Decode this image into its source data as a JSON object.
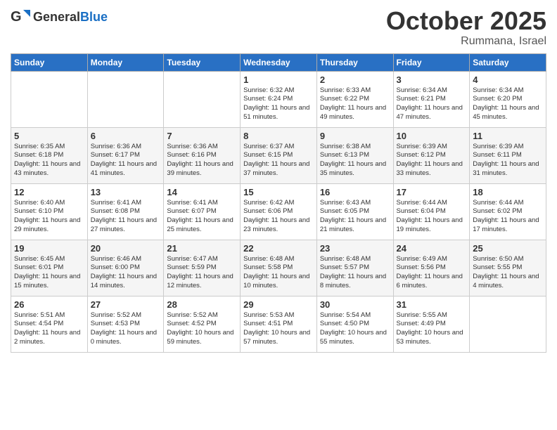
{
  "header": {
    "logo_general": "General",
    "logo_blue": "Blue",
    "month": "October 2025",
    "location": "Rummana, Israel"
  },
  "weekdays": [
    "Sunday",
    "Monday",
    "Tuesday",
    "Wednesday",
    "Thursday",
    "Friday",
    "Saturday"
  ],
  "weeks": [
    [
      {
        "day": "",
        "sunrise": "",
        "sunset": "",
        "daylight": ""
      },
      {
        "day": "",
        "sunrise": "",
        "sunset": "",
        "daylight": ""
      },
      {
        "day": "",
        "sunrise": "",
        "sunset": "",
        "daylight": ""
      },
      {
        "day": "1",
        "sunrise": "Sunrise: 6:32 AM",
        "sunset": "Sunset: 6:24 PM",
        "daylight": "Daylight: 11 hours and 51 minutes."
      },
      {
        "day": "2",
        "sunrise": "Sunrise: 6:33 AM",
        "sunset": "Sunset: 6:22 PM",
        "daylight": "Daylight: 11 hours and 49 minutes."
      },
      {
        "day": "3",
        "sunrise": "Sunrise: 6:34 AM",
        "sunset": "Sunset: 6:21 PM",
        "daylight": "Daylight: 11 hours and 47 minutes."
      },
      {
        "day": "4",
        "sunrise": "Sunrise: 6:34 AM",
        "sunset": "Sunset: 6:20 PM",
        "daylight": "Daylight: 11 hours and 45 minutes."
      }
    ],
    [
      {
        "day": "5",
        "sunrise": "Sunrise: 6:35 AM",
        "sunset": "Sunset: 6:18 PM",
        "daylight": "Daylight: 11 hours and 43 minutes."
      },
      {
        "day": "6",
        "sunrise": "Sunrise: 6:36 AM",
        "sunset": "Sunset: 6:17 PM",
        "daylight": "Daylight: 11 hours and 41 minutes."
      },
      {
        "day": "7",
        "sunrise": "Sunrise: 6:36 AM",
        "sunset": "Sunset: 6:16 PM",
        "daylight": "Daylight: 11 hours and 39 minutes."
      },
      {
        "day": "8",
        "sunrise": "Sunrise: 6:37 AM",
        "sunset": "Sunset: 6:15 PM",
        "daylight": "Daylight: 11 hours and 37 minutes."
      },
      {
        "day": "9",
        "sunrise": "Sunrise: 6:38 AM",
        "sunset": "Sunset: 6:13 PM",
        "daylight": "Daylight: 11 hours and 35 minutes."
      },
      {
        "day": "10",
        "sunrise": "Sunrise: 6:39 AM",
        "sunset": "Sunset: 6:12 PM",
        "daylight": "Daylight: 11 hours and 33 minutes."
      },
      {
        "day": "11",
        "sunrise": "Sunrise: 6:39 AM",
        "sunset": "Sunset: 6:11 PM",
        "daylight": "Daylight: 11 hours and 31 minutes."
      }
    ],
    [
      {
        "day": "12",
        "sunrise": "Sunrise: 6:40 AM",
        "sunset": "Sunset: 6:10 PM",
        "daylight": "Daylight: 11 hours and 29 minutes."
      },
      {
        "day": "13",
        "sunrise": "Sunrise: 6:41 AM",
        "sunset": "Sunset: 6:08 PM",
        "daylight": "Daylight: 11 hours and 27 minutes."
      },
      {
        "day": "14",
        "sunrise": "Sunrise: 6:41 AM",
        "sunset": "Sunset: 6:07 PM",
        "daylight": "Daylight: 11 hours and 25 minutes."
      },
      {
        "day": "15",
        "sunrise": "Sunrise: 6:42 AM",
        "sunset": "Sunset: 6:06 PM",
        "daylight": "Daylight: 11 hours and 23 minutes."
      },
      {
        "day": "16",
        "sunrise": "Sunrise: 6:43 AM",
        "sunset": "Sunset: 6:05 PM",
        "daylight": "Daylight: 11 hours and 21 minutes."
      },
      {
        "day": "17",
        "sunrise": "Sunrise: 6:44 AM",
        "sunset": "Sunset: 6:04 PM",
        "daylight": "Daylight: 11 hours and 19 minutes."
      },
      {
        "day": "18",
        "sunrise": "Sunrise: 6:44 AM",
        "sunset": "Sunset: 6:02 PM",
        "daylight": "Daylight: 11 hours and 17 minutes."
      }
    ],
    [
      {
        "day": "19",
        "sunrise": "Sunrise: 6:45 AM",
        "sunset": "Sunset: 6:01 PM",
        "daylight": "Daylight: 11 hours and 15 minutes."
      },
      {
        "day": "20",
        "sunrise": "Sunrise: 6:46 AM",
        "sunset": "Sunset: 6:00 PM",
        "daylight": "Daylight: 11 hours and 14 minutes."
      },
      {
        "day": "21",
        "sunrise": "Sunrise: 6:47 AM",
        "sunset": "Sunset: 5:59 PM",
        "daylight": "Daylight: 11 hours and 12 minutes."
      },
      {
        "day": "22",
        "sunrise": "Sunrise: 6:48 AM",
        "sunset": "Sunset: 5:58 PM",
        "daylight": "Daylight: 11 hours and 10 minutes."
      },
      {
        "day": "23",
        "sunrise": "Sunrise: 6:48 AM",
        "sunset": "Sunset: 5:57 PM",
        "daylight": "Daylight: 11 hours and 8 minutes."
      },
      {
        "day": "24",
        "sunrise": "Sunrise: 6:49 AM",
        "sunset": "Sunset: 5:56 PM",
        "daylight": "Daylight: 11 hours and 6 minutes."
      },
      {
        "day": "25",
        "sunrise": "Sunrise: 6:50 AM",
        "sunset": "Sunset: 5:55 PM",
        "daylight": "Daylight: 11 hours and 4 minutes."
      }
    ],
    [
      {
        "day": "26",
        "sunrise": "Sunrise: 5:51 AM",
        "sunset": "Sunset: 4:54 PM",
        "daylight": "Daylight: 11 hours and 2 minutes."
      },
      {
        "day": "27",
        "sunrise": "Sunrise: 5:52 AM",
        "sunset": "Sunset: 4:53 PM",
        "daylight": "Daylight: 11 hours and 0 minutes."
      },
      {
        "day": "28",
        "sunrise": "Sunrise: 5:52 AM",
        "sunset": "Sunset: 4:52 PM",
        "daylight": "Daylight: 10 hours and 59 minutes."
      },
      {
        "day": "29",
        "sunrise": "Sunrise: 5:53 AM",
        "sunset": "Sunset: 4:51 PM",
        "daylight": "Daylight: 10 hours and 57 minutes."
      },
      {
        "day": "30",
        "sunrise": "Sunrise: 5:54 AM",
        "sunset": "Sunset: 4:50 PM",
        "daylight": "Daylight: 10 hours and 55 minutes."
      },
      {
        "day": "31",
        "sunrise": "Sunrise: 5:55 AM",
        "sunset": "Sunset: 4:49 PM",
        "daylight": "Daylight: 10 hours and 53 minutes."
      },
      {
        "day": "",
        "sunrise": "",
        "sunset": "",
        "daylight": ""
      }
    ]
  ]
}
